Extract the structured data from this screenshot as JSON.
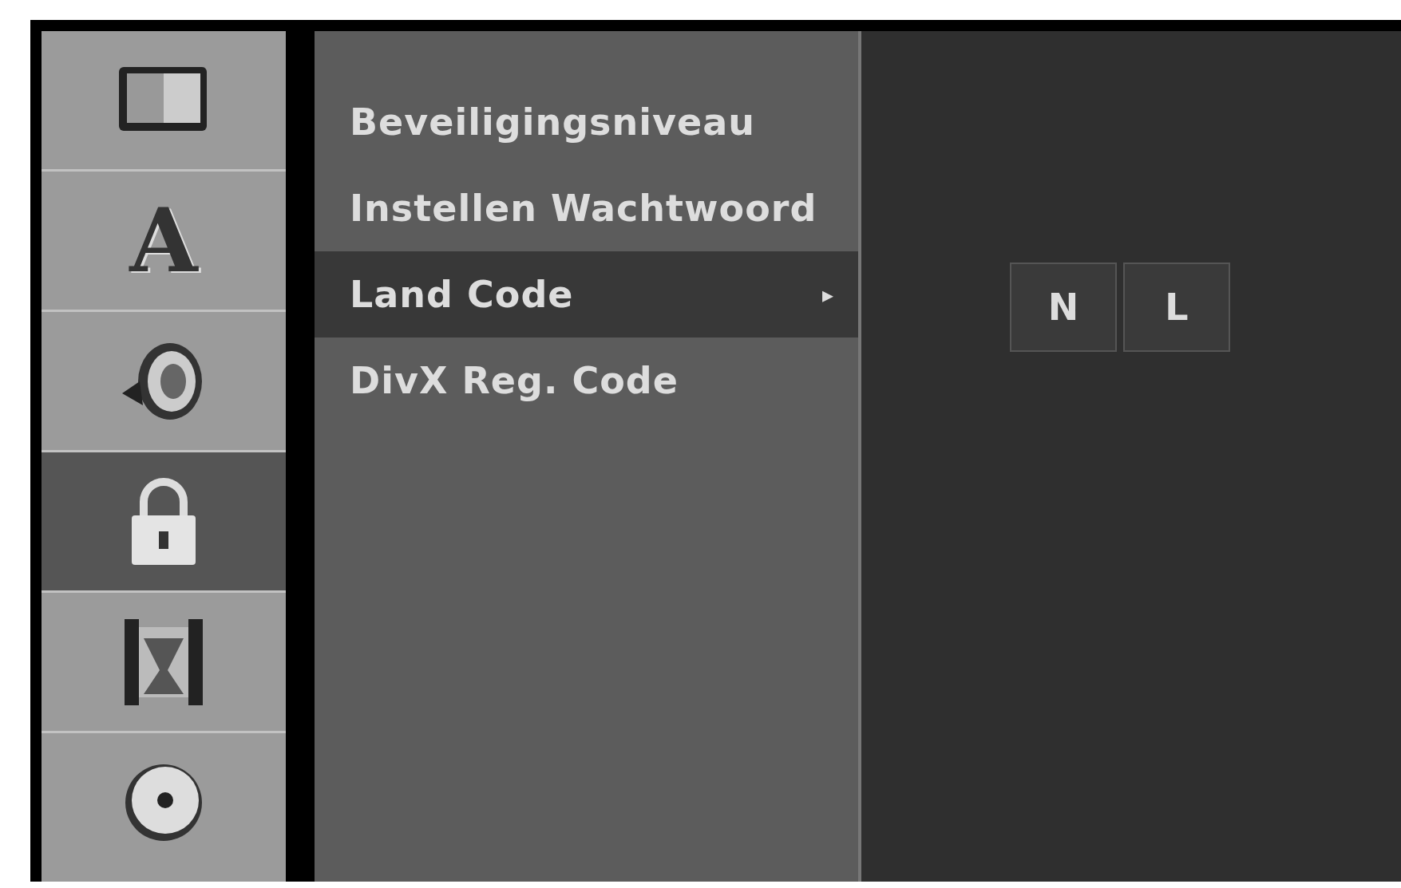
{
  "sidebar": {
    "items": [
      {
        "kind": "display",
        "selected": false
      },
      {
        "kind": "language",
        "glyph": "A",
        "selected": false
      },
      {
        "kind": "audio",
        "selected": false
      },
      {
        "kind": "lock",
        "selected": true
      },
      {
        "kind": "film",
        "selected": false
      },
      {
        "kind": "disc",
        "selected": false
      }
    ]
  },
  "menu": {
    "items": [
      {
        "label": "Beveiligingsniveau",
        "selected": false
      },
      {
        "label": "Instellen Wachtwoord",
        "selected": false
      },
      {
        "label": "Land Code",
        "selected": true,
        "marker": "▸"
      },
      {
        "label": "DivX Reg. Code",
        "selected": false
      }
    ]
  },
  "code_boxes": [
    "N",
    "L"
  ]
}
